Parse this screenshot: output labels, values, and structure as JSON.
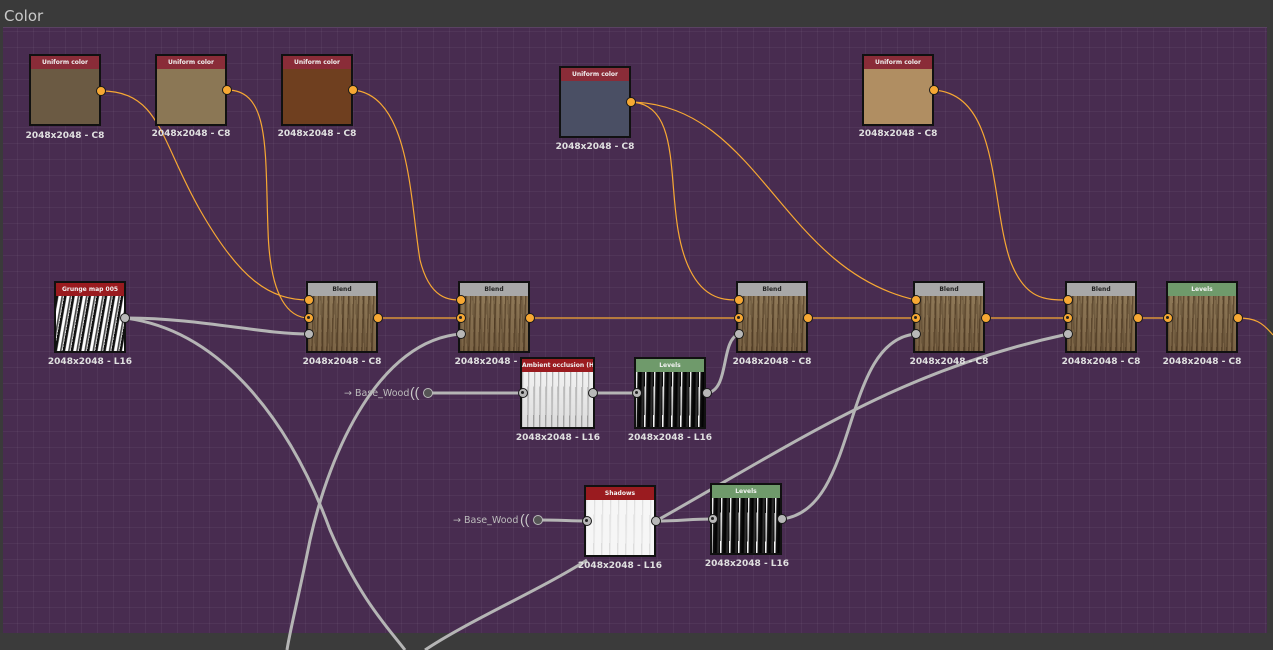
{
  "frame": {
    "title": "Color",
    "background": "#482c50",
    "wire_color": "#f7a833"
  },
  "nodes": {
    "uc1": {
      "title": "Uniform color",
      "label": "2048x2048 - C8",
      "color": "#6b5a43"
    },
    "uc2": {
      "title": "Uniform color",
      "label": "2048x2048 - C8",
      "color": "#8b7755"
    },
    "uc3": {
      "title": "Uniform color",
      "label": "2048x2048 - C8",
      "color": "#6f3f1f"
    },
    "uc4": {
      "title": "Uniform color",
      "label": "2048x2048 - C8",
      "color": "#4a4f64"
    },
    "uc5": {
      "title": "Uniform color",
      "label": "2048x2048 - C8",
      "color": "#b08e62"
    },
    "grunge": {
      "title": "Grunge map 005",
      "label": "2048x2048 - L16"
    },
    "blend1": {
      "title": "Blend",
      "label": "2048x2048 - C8"
    },
    "blend2": {
      "title": "Blend",
      "label": "2048x2048 - C8"
    },
    "blend3": {
      "title": "Blend",
      "label": "2048x2048 - C8"
    },
    "blend4": {
      "title": "Blend",
      "label": "2048x2048 - C8"
    },
    "blend5": {
      "title": "Blend",
      "label": "2048x2048 - C8"
    },
    "levels_out": {
      "title": "Levels",
      "label": "2048x2048 - C8"
    },
    "ao": {
      "title": "Ambient occlusion (HBAO)",
      "label": "2048x2048 - L16"
    },
    "levels1": {
      "title": "Levels",
      "label": "2048x2048 - L16"
    },
    "shadows": {
      "title": "Shadows",
      "label": "2048x2048 - L16"
    },
    "levels2": {
      "title": "Levels",
      "label": "2048x2048 - L16"
    }
  },
  "inputs": {
    "base_wood_1": {
      "label": "→ Base_Wood"
    },
    "base_wood_2": {
      "label": "→ Base_Wood"
    }
  }
}
